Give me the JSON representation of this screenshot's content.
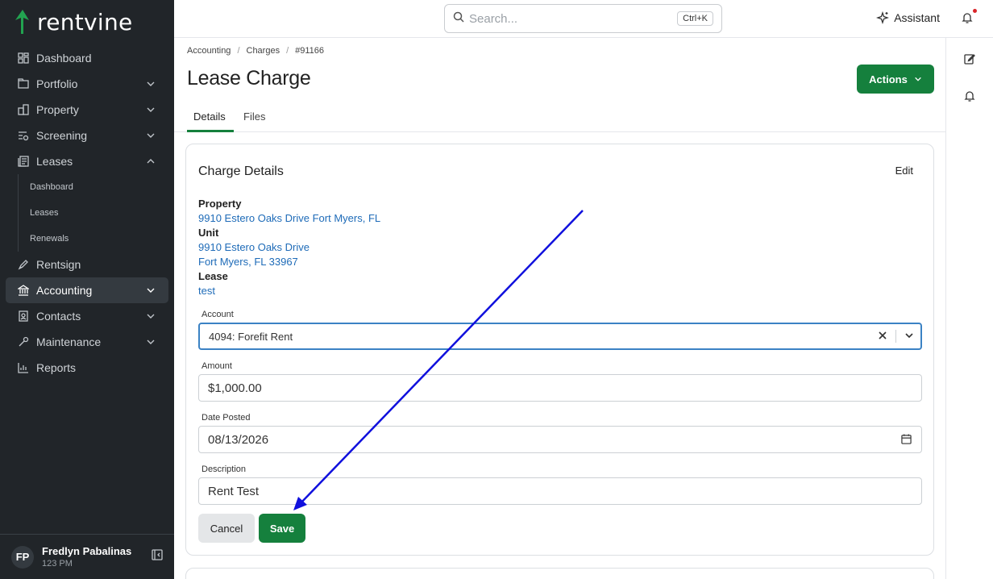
{
  "brand": {
    "name": "rentvine",
    "accent": "#15803d",
    "sidebar_bg": "#212529"
  },
  "sidebar": {
    "items": [
      {
        "label": "Dashboard",
        "icon": "dashboard-icon",
        "has_chevron": false
      },
      {
        "label": "Portfolio",
        "icon": "portfolio-icon",
        "has_chevron": true
      },
      {
        "label": "Property",
        "icon": "property-icon",
        "has_chevron": true
      },
      {
        "label": "Screening",
        "icon": "screening-icon",
        "has_chevron": true
      },
      {
        "label": "Leases",
        "icon": "leases-icon",
        "has_chevron": true,
        "expanded": true
      },
      {
        "label": "Rentsign",
        "icon": "rentsign-icon",
        "has_chevron": false
      },
      {
        "label": "Accounting",
        "icon": "accounting-icon",
        "has_chevron": true,
        "active": true
      },
      {
        "label": "Contacts",
        "icon": "contacts-icon",
        "has_chevron": true
      },
      {
        "label": "Maintenance",
        "icon": "maintenance-icon",
        "has_chevron": true
      },
      {
        "label": "Reports",
        "icon": "reports-icon",
        "has_chevron": false
      }
    ],
    "leases_sub": [
      "Dashboard",
      "Leases",
      "Renewals"
    ]
  },
  "user": {
    "initials": "FP",
    "name": "Fredlyn Pabalinas",
    "sub": "123 PM"
  },
  "topbar": {
    "search_placeholder": "Search...",
    "shortcut": "Ctrl+K",
    "assistant": "Assistant"
  },
  "breadcrumb": [
    "Accounting",
    "Charges",
    "#91166"
  ],
  "page": {
    "title": "Lease Charge",
    "actions_label": "Actions"
  },
  "tabs": [
    "Details",
    "Files"
  ],
  "card": {
    "title": "Charge Details",
    "edit": "Edit",
    "property_label": "Property",
    "property_value": "9910 Estero Oaks Drive Fort Myers, FL",
    "unit_label": "Unit",
    "unit_line1": "9910 Estero Oaks Drive",
    "unit_line2": "Fort Myers, FL 33967",
    "lease_label": "Lease",
    "lease_value": "test",
    "account_label": "Account",
    "account_value": "4094: Forefit Rent",
    "amount_label": "Amount",
    "amount_value": "$1,000.00",
    "date_label": "Date Posted",
    "date_value": "08/13/2026",
    "description_label": "Description",
    "description_value": "Rent Test",
    "cancel": "Cancel",
    "save": "Save"
  },
  "annotation": {
    "color": "#1010dd"
  }
}
